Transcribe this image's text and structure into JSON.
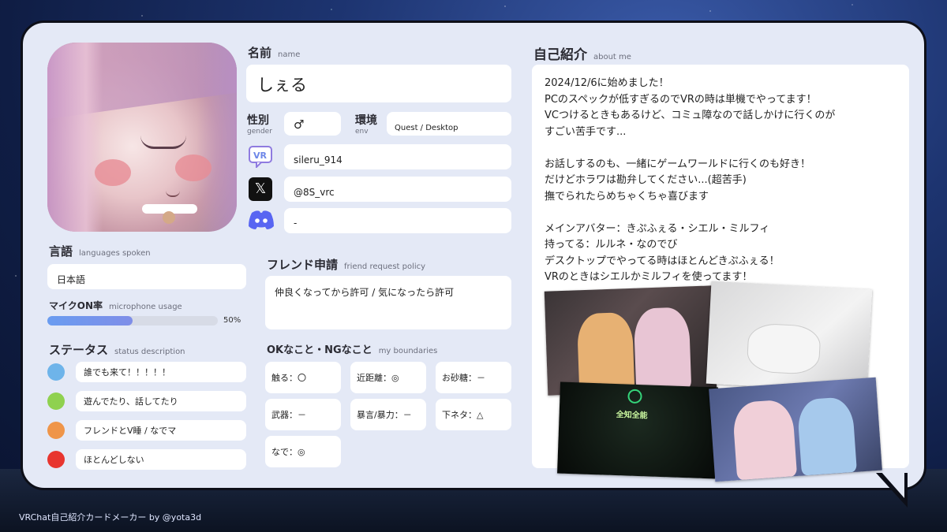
{
  "name": {
    "label": "名前",
    "sub": "name",
    "value": "しぇる"
  },
  "gender": {
    "label": "性別",
    "sub": "gender",
    "value": "♂"
  },
  "env": {
    "label": "環境",
    "sub": "env",
    "value": "Quest / Desktop"
  },
  "vrchat": {
    "icon": "vrchat-icon",
    "value": "sileru_914"
  },
  "x": {
    "icon": "x-icon",
    "value": "@8S_vrc"
  },
  "discord": {
    "icon": "discord-icon",
    "value": "-"
  },
  "languages": {
    "label": "言語",
    "sub": "languages spoken",
    "value": "日本語"
  },
  "mic": {
    "label": "マイクON率",
    "sub": "microphone usage",
    "percent": 50,
    "percent_text": "50%"
  },
  "status": {
    "label": "ステータス",
    "sub": "status description",
    "items": [
      {
        "color": "#6eb4ea",
        "text": "誰でも来て！！！！！"
      },
      {
        "color": "#8fd14f",
        "text": "遊んでたり、話してたり"
      },
      {
        "color": "#ef9549",
        "text": "フレンドとV睡 / なでマ"
      },
      {
        "color": "#e8352f",
        "text": "ほとんどしない"
      }
    ]
  },
  "friend": {
    "label": "フレンド申請",
    "sub": "friend request policy",
    "value": "仲良くなってから許可 / 気になったら許可"
  },
  "boundaries": {
    "label": "OKなこと・NGなこと",
    "sub": "my boundaries",
    "items": [
      "触る：〇",
      "近距離：◎",
      "お砂糖：－",
      "武器：－",
      "暴言/暴力：－",
      "下ネタ：△",
      "なで：◎"
    ]
  },
  "about": {
    "label": "自己紹介",
    "sub": "about me",
    "lines": [
      "2024/12/6に始めました！",
      "PCのスペックが低すぎるのでVRの時は単機でやってます！",
      "VCつけるときもあるけど、コミュ障なので話しかけに行くのが",
      "すごい苦手です...",
      "",
      "お話しするのも、一緒にゲームワールドに行くのも好き！",
      "だけどホラワは勘弁してください...(超苦手)",
      "撫でられたらめちゃくちゃ喜びます",
      "",
      "メインアバター：きぷふぇる・シエル・ミルフィ",
      "持ってる：ルルネ・なのでび",
      "デスクトップでやってる時はほとんどきぷふぇる！",
      "VRのときはシエルかミルフィを使ってます！"
    ],
    "photo_caption": "全知全能"
  },
  "footer": "VRChat自己紹介カードメーカー by @yota3d"
}
